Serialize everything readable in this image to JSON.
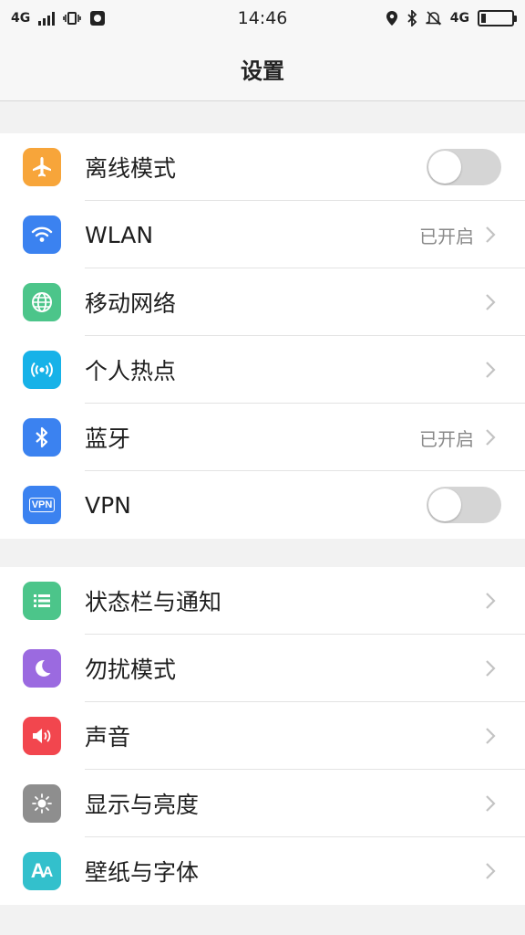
{
  "status_bar": {
    "network_left": "4G",
    "network_right": "4G",
    "time": "14:46",
    "battery_level": 0.16
  },
  "header": {
    "title": "设置"
  },
  "colors": {
    "airplane": "#f7a53a",
    "wlan": "#3b82f0",
    "mobile": "#4cc58a",
    "hotspot": "#17b2e8",
    "bluetooth": "#3b82f0",
    "vpn": "#3b82f0",
    "statusbar_notify": "#4cc58a",
    "dnd": "#9b6ae0",
    "sound": "#f2464e",
    "display": "#8e8e8e",
    "wallpaper": "#33c0cc"
  },
  "group1": {
    "items": [
      {
        "label": "离线模式",
        "icon": "airplane-icon",
        "control": "toggle",
        "on": false
      },
      {
        "label": "WLAN",
        "icon": "wifi-icon",
        "value": "已开启",
        "control": "chevron"
      },
      {
        "label": "移动网络",
        "icon": "globe-icon",
        "control": "chevron"
      },
      {
        "label": "个人热点",
        "icon": "hotspot-icon",
        "control": "chevron"
      },
      {
        "label": "蓝牙",
        "icon": "bluetooth-icon",
        "value": "已开启",
        "control": "chevron"
      },
      {
        "label": "VPN",
        "icon": "vpn-icon",
        "icon_text": "VPN",
        "control": "toggle",
        "on": false
      }
    ]
  },
  "group2": {
    "items": [
      {
        "label": "状态栏与通知",
        "icon": "list-icon",
        "control": "chevron"
      },
      {
        "label": "勿扰模式",
        "icon": "moon-icon",
        "control": "chevron"
      },
      {
        "label": "声音",
        "icon": "speaker-icon",
        "control": "chevron"
      },
      {
        "label": "显示与亮度",
        "icon": "brightness-icon",
        "control": "chevron"
      },
      {
        "label": "壁纸与字体",
        "icon": "font-icon",
        "icon_text": "A",
        "control": "chevron"
      }
    ]
  }
}
